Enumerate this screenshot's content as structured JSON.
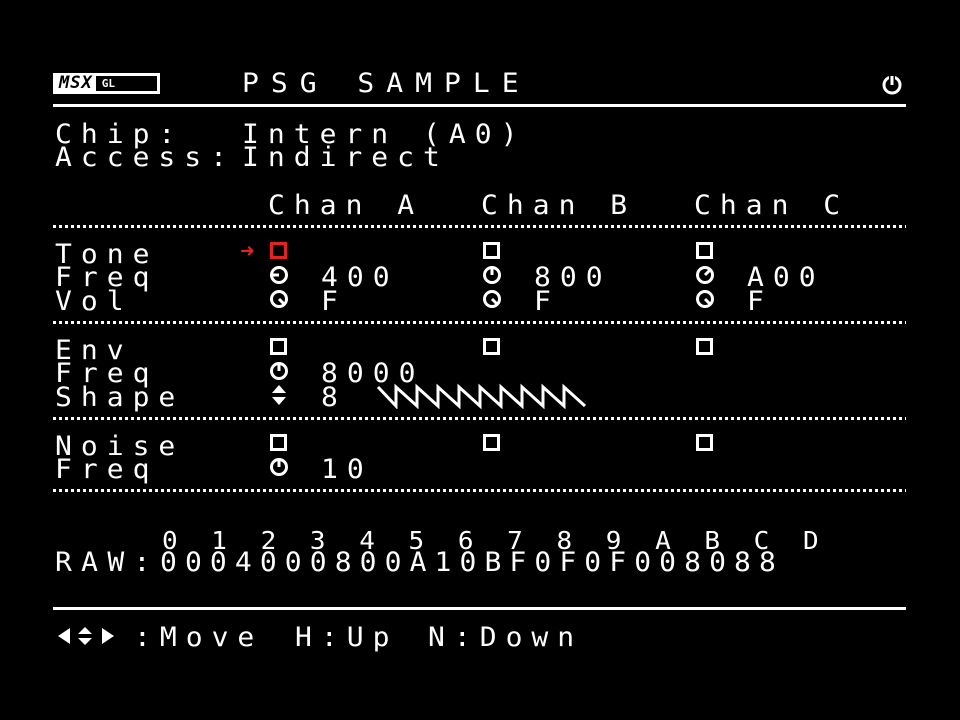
{
  "header": {
    "logo_main": "MSX",
    "logo_sub": "GL",
    "title": "PSG SAMPLE",
    "power_icon": "power-icon"
  },
  "info": {
    "chip_label": "Chip:",
    "chip_value": "Intern (A0)",
    "access_label": "Access:",
    "access_value": "Indirect"
  },
  "channels": {
    "a": "Chan A",
    "b": "Chan B",
    "c": "Chan C"
  },
  "tone": {
    "label_tone": "Tone",
    "label_freq": "Freq",
    "label_vol": "Vol",
    "freq_a": "400",
    "freq_b": "800",
    "freq_c": "A00",
    "vol_a": "F",
    "vol_b": "F",
    "vol_c": "F"
  },
  "env": {
    "label_env": "Env",
    "label_freq": "Freq",
    "label_shape": "Shape",
    "freq": "8000",
    "shape": "8"
  },
  "noise": {
    "label_noise": "Noise",
    "label_freq": "Freq",
    "freq": "10"
  },
  "raw": {
    "indices": "0 1 2 3 4 5 6 7 8 9 A B C D",
    "label": "RAW:",
    "values": "0004000800A10BF0F0F008088"
  },
  "footer": {
    "move_label": ":Move",
    "up_label": "H:Up",
    "down_label": "N:Down"
  },
  "colors": {
    "background": "#000000",
    "foreground": "#ffffff",
    "cursor": "#e52222"
  }
}
